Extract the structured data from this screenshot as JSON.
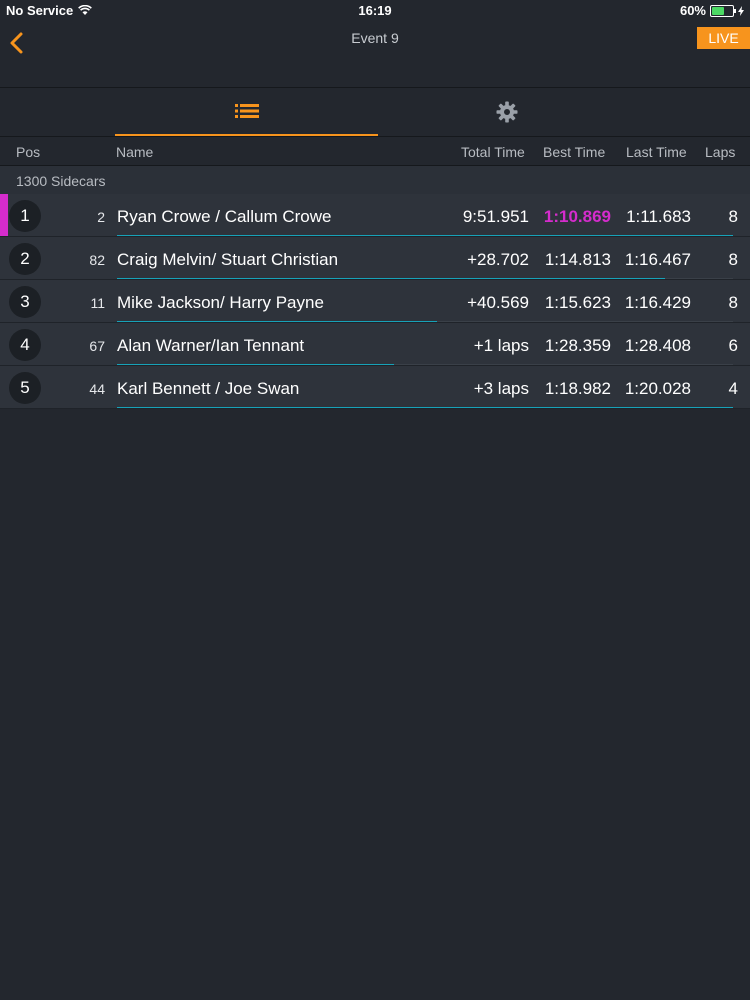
{
  "status_bar": {
    "carrier": "No Service",
    "time": "16:19",
    "battery": "60%"
  },
  "nav": {
    "title": "Event 9",
    "live_label": "LIVE"
  },
  "columns": {
    "pos": "Pos",
    "name": "Name",
    "total": "Total Time",
    "best": "Best Time",
    "last": "Last Time",
    "laps": "Laps"
  },
  "group_label": "1300 Sidecars",
  "colors": {
    "accent": "#f7941d",
    "fastest": "#d52ccc",
    "progress": "#17a2b8"
  },
  "rows": [
    {
      "pos": "1",
      "number": "2",
      "name": "Ryan Crowe / Callum Crowe",
      "total": "9:51.951",
      "best": "1:10.869",
      "last": "1:11.683",
      "laps": "8",
      "progress": 1.0,
      "fastest": true,
      "leader": true
    },
    {
      "pos": "2",
      "number": "82",
      "name": "Craig Melvin/ Stuart Christian",
      "total": "+28.702",
      "best": "1:14.813",
      "last": "1:16.467",
      "laps": "8",
      "progress": 0.89,
      "fastest": false,
      "leader": false
    },
    {
      "pos": "3",
      "number": "11",
      "name": "Mike Jackson/ Harry Payne",
      "total": "+40.569",
      "best": "1:15.623",
      "last": "1:16.429",
      "laps": "8",
      "progress": 0.52,
      "fastest": false,
      "leader": false
    },
    {
      "pos": "4",
      "number": "67",
      "name": "Alan Warner/Ian Tennant",
      "total": "+1 laps",
      "best": "1:28.359",
      "last": "1:28.408",
      "laps": "6",
      "progress": 0.45,
      "fastest": false,
      "leader": false
    },
    {
      "pos": "5",
      "number": "44",
      "name": "Karl Bennett / Joe Swan",
      "total": "+3 laps",
      "best": "1:18.982",
      "last": "1:20.028",
      "laps": "4",
      "progress": 1.0,
      "fastest": false,
      "leader": false
    }
  ]
}
